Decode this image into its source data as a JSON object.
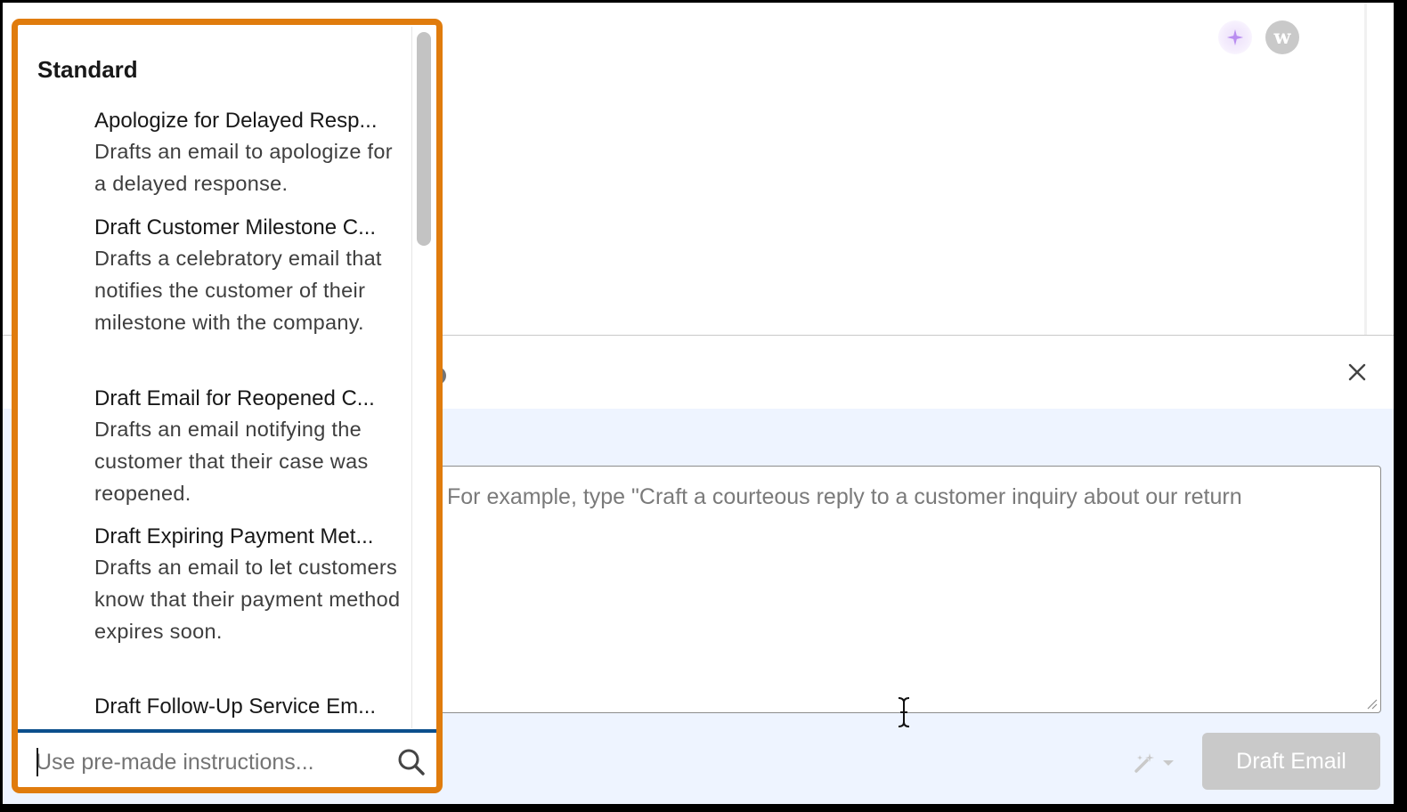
{
  "top": {
    "ai_avatar_icon": "sparkle-icon",
    "user_avatar_letter": "w"
  },
  "composer": {
    "close_icon": "close-icon",
    "prompt_placeholder": "For example, type \"Craft a courteous reply to a customer inquiry about our return",
    "wand_icon": "magic-wand-icon",
    "draft_button_label": "Draft Email"
  },
  "dropdown": {
    "group_label": "Standard",
    "options": [
      {
        "title": "Apologize for Delayed Resp...",
        "desc": "Drafts an email to apologize for a delayed response."
      },
      {
        "title": "Draft Customer Milestone C...",
        "desc": "Drafts a celebratory email that notifies the customer of their milestone with the company."
      },
      {
        "title": "Draft Email for Reopened C...",
        "desc": "Drafts an email notifying the customer that their case was reopened."
      },
      {
        "title": "Draft Expiring Payment Met...",
        "desc": "Drafts an email to let customers know that their payment method expires soon."
      },
      {
        "title": "Draft Follow-Up Service Em...",
        "desc": ""
      }
    ],
    "search_placeholder": "Use pre-made instructions..."
  },
  "colors": {
    "highlight_border": "#e07c0d",
    "focus_accent": "#0b4f8c",
    "composer_bg": "#eef4ff",
    "disabled_button": "#c9c9c9"
  }
}
